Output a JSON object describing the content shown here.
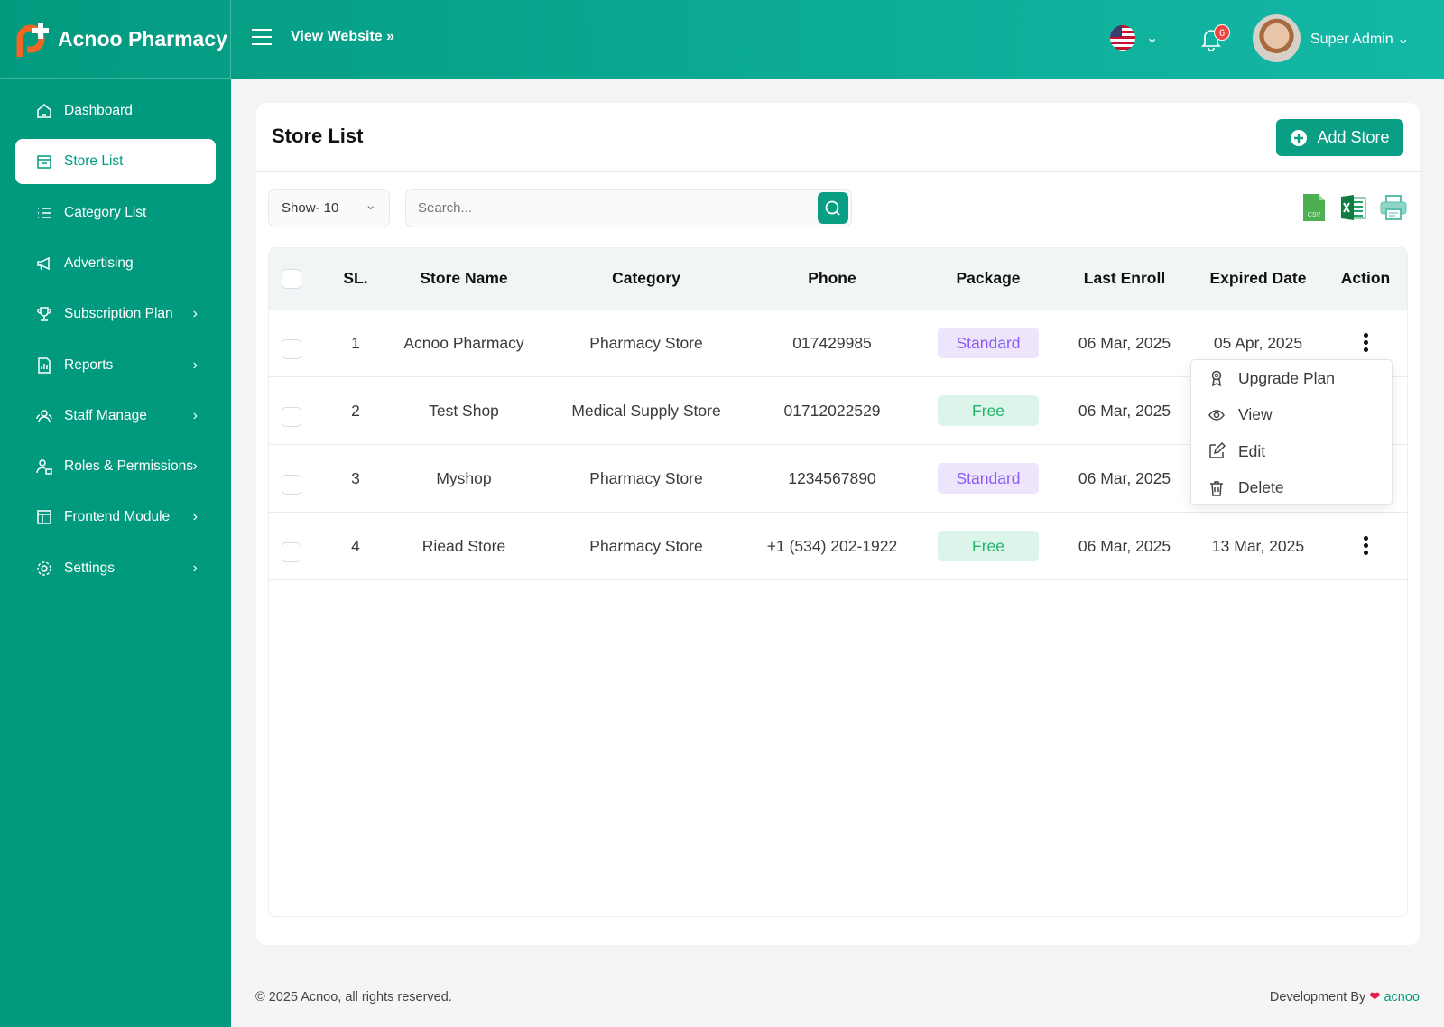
{
  "brand": {
    "name": "Acnoo Pharmacy",
    "accent": "#029a7f"
  },
  "topbar": {
    "view_website": "View Website",
    "notification_count": "6",
    "user_name": "Super Admin",
    "language_flag": "us-flag-icon"
  },
  "sidebar": {
    "items": [
      {
        "label": "Dashboard",
        "icon": "home-icon"
      },
      {
        "label": "Store List",
        "icon": "store-icon",
        "active": true
      },
      {
        "label": "Category List",
        "icon": "list-icon"
      },
      {
        "label": "Advertising",
        "icon": "megaphone-icon"
      },
      {
        "label": "Subscription Plan",
        "icon": "trophy-icon",
        "submenu": true
      },
      {
        "label": "Reports",
        "icon": "report-icon",
        "submenu": true
      },
      {
        "label": "Staff Manage",
        "icon": "users-icon",
        "submenu": true
      },
      {
        "label": "Roles & Permissions",
        "icon": "user-lock-icon",
        "submenu": true
      },
      {
        "label": "Frontend Module",
        "icon": "layout-icon",
        "submenu": true
      },
      {
        "label": "Settings",
        "icon": "gear-icon",
        "submenu": true
      }
    ]
  },
  "main": {
    "title": "Store List",
    "add_button": "Add Store",
    "show_select": "Show- 10",
    "search_placeholder": "Search...",
    "export": {
      "csv": "CSV"
    },
    "columns": [
      "SL.",
      "Store Name",
      "Category",
      "Phone",
      "Package",
      "Last Enroll",
      "Expired Date",
      "Action"
    ],
    "rows": [
      {
        "sl": "1",
        "name": "Acnoo Pharmacy",
        "category": "Pharmacy Store",
        "phone": "017429985",
        "package": "Standard",
        "last_enroll": "06 Mar, 2025",
        "expired": "05 Apr, 2025"
      },
      {
        "sl": "2",
        "name": "Test Shop",
        "category": "Medical Supply Store",
        "phone": "01712022529",
        "package": "Free",
        "last_enroll": "06 Mar, 2025",
        "expired": ""
      },
      {
        "sl": "3",
        "name": "Myshop",
        "category": "Pharmacy Store",
        "phone": "1234567890",
        "package": "Standard",
        "last_enroll": "06 Mar, 2025",
        "expired": ""
      },
      {
        "sl": "4",
        "name": "Riead Store",
        "category": "Pharmacy Store",
        "phone": "+1 (534) 202-1922",
        "package": "Free",
        "last_enroll": "06 Mar, 2025",
        "expired": "13 Mar, 2025"
      }
    ],
    "action_menu": [
      "Upgrade Plan",
      "View",
      "Edit",
      "Delete"
    ]
  },
  "footer": {
    "copyright": "© 2025 Acnoo, all rights reserved.",
    "dev_by": "Development By",
    "dev_link": "acnoo"
  }
}
